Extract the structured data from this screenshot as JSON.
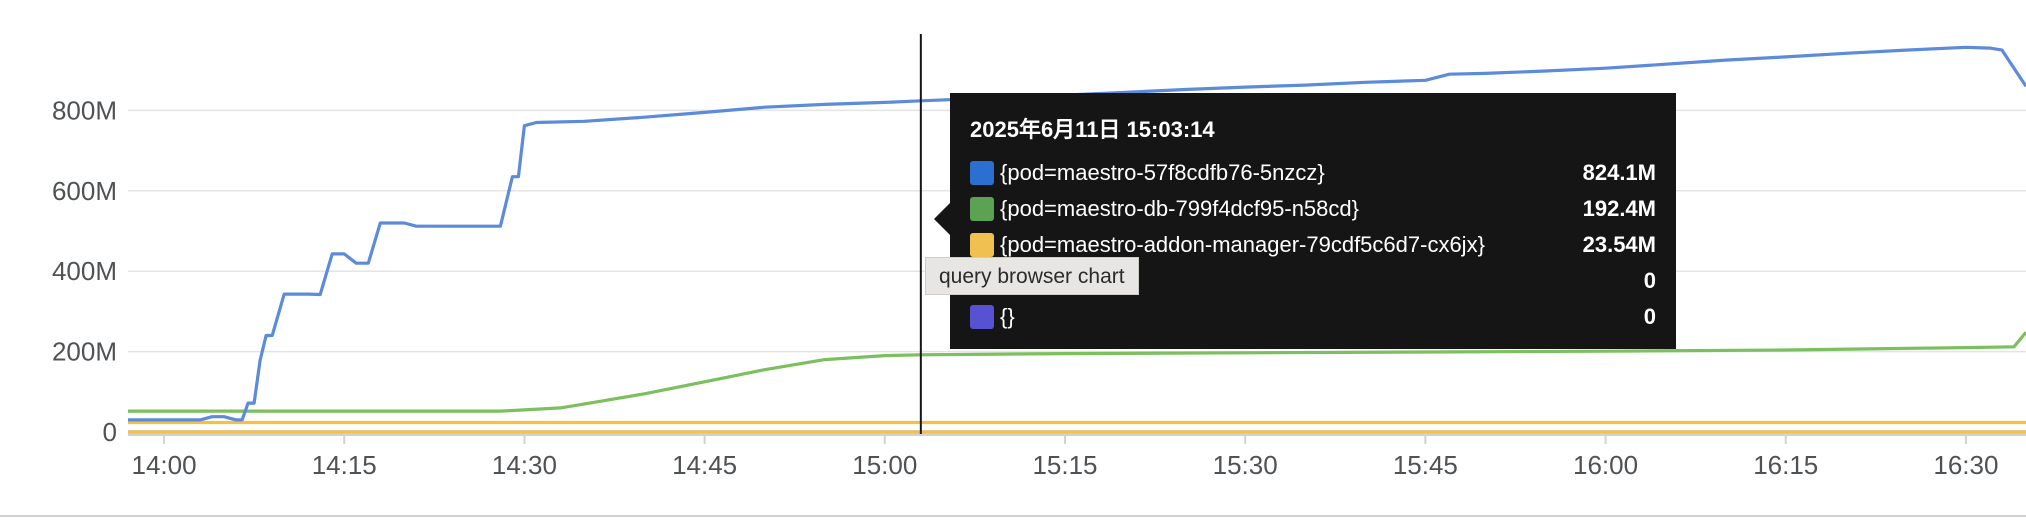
{
  "chart_data": {
    "type": "line",
    "title": "",
    "xlabel": "",
    "ylabel": "",
    "x_ticks": [
      "14:00",
      "14:15",
      "14:30",
      "14:45",
      "15:00",
      "15:15",
      "15:30",
      "15:45",
      "16:00",
      "16:15",
      "16:30"
    ],
    "xlim": [
      "13:57",
      "16:35"
    ],
    "y_ticks": [
      "0",
      "200M",
      "400M",
      "600M",
      "800M"
    ],
    "y_tick_values": [
      0,
      200,
      400,
      600,
      800
    ],
    "ylim": [
      0,
      1000
    ],
    "y_unit": "M",
    "grid": "horizontal",
    "legend": "none",
    "series": [
      {
        "name": "{pod=maestro-57f8cdfb76-5nzcz}",
        "color": "#5b8bd9",
        "points": [
          [
            "13:57",
            30
          ],
          [
            "14:03",
            30
          ],
          [
            "14:04",
            38
          ],
          [
            "14:05",
            38
          ],
          [
            "14:06",
            30
          ],
          [
            "14:06.5",
            30
          ],
          [
            "14:07",
            72
          ],
          [
            "14:07.5",
            72
          ],
          [
            "14:08",
            178
          ],
          [
            "14:08.5",
            240
          ],
          [
            "14:09",
            240
          ],
          [
            "14:10",
            343
          ],
          [
            "14:12",
            343
          ],
          [
            "14:13",
            342
          ],
          [
            "14:14",
            443
          ],
          [
            "14:15",
            443
          ],
          [
            "14:16",
            420
          ],
          [
            "14:17",
            420
          ],
          [
            "14:18",
            520
          ],
          [
            "14:20",
            520
          ],
          [
            "14:21",
            512
          ],
          [
            "14:28",
            512
          ],
          [
            "14:29",
            635
          ],
          [
            "14:29.5",
            635
          ],
          [
            "14:30",
            762
          ],
          [
            "14:31",
            770
          ],
          [
            "14:35",
            773
          ],
          [
            "14:40",
            783
          ],
          [
            "14:45",
            795
          ],
          [
            "14:50",
            808
          ],
          [
            "14:55",
            815
          ],
          [
            "15:00",
            820
          ],
          [
            "15:03",
            824
          ],
          [
            "15:10",
            832
          ],
          [
            "15:15",
            838
          ],
          [
            "15:20",
            845
          ],
          [
            "15:25",
            852
          ],
          [
            "15:30",
            858
          ],
          [
            "15:35",
            863
          ],
          [
            "15:40",
            870
          ],
          [
            "15:45",
            875
          ],
          [
            "15:47",
            890
          ],
          [
            "15:50",
            892
          ],
          [
            "15:55",
            898
          ],
          [
            "16:00",
            905
          ],
          [
            "16:05",
            915
          ],
          [
            "16:10",
            925
          ],
          [
            "16:15",
            933
          ],
          [
            "16:20",
            942
          ],
          [
            "16:25",
            950
          ],
          [
            "16:30",
            957
          ],
          [
            "16:32",
            955
          ],
          [
            "16:33",
            950
          ],
          [
            "16:34",
            905
          ],
          [
            "16:35",
            860
          ]
        ]
      },
      {
        "name": "{pod=maestro-db-799f4dcf95-n58cd}",
        "color": "#7bbf5e",
        "points": [
          [
            "13:57",
            52
          ],
          [
            "14:05",
            52
          ],
          [
            "14:28",
            52
          ],
          [
            "14:30",
            55
          ],
          [
            "14:33",
            60
          ],
          [
            "14:36",
            75
          ],
          [
            "14:40",
            95
          ],
          [
            "14:45",
            125
          ],
          [
            "14:50",
            155
          ],
          [
            "14:55",
            180
          ],
          [
            "15:00",
            190
          ],
          [
            "15:03",
            192
          ],
          [
            "15:15",
            195
          ],
          [
            "15:30",
            197
          ],
          [
            "15:45",
            199
          ],
          [
            "16:00",
            201
          ],
          [
            "16:15",
            204
          ],
          [
            "16:30",
            210
          ],
          [
            "16:34",
            212
          ],
          [
            "16:35",
            248
          ]
        ]
      },
      {
        "name": "{pod=maestro-addon-manager-79cdf5c6d7-cx6jx}",
        "color": "#f4c145",
        "points": [
          [
            "13:57",
            23.54
          ],
          [
            "16:35",
            23.54
          ]
        ]
      },
      {
        "name": "",
        "color": "#f4c145",
        "points": [
          [
            "13:57",
            0
          ],
          [
            "16:35",
            0
          ]
        ]
      },
      {
        "name": "{}",
        "color": "#5752d1",
        "points": [
          [
            "13:57",
            0
          ],
          [
            "16:35",
            0
          ]
        ]
      }
    ],
    "hover": {
      "time": "15:03",
      "title": "2025年6月11日 15:03:14",
      "rows": [
        {
          "name": "{pod=maestro-57f8cdfb76-5nzcz}",
          "value": "824.1M",
          "color": "#2b6fd0"
        },
        {
          "name": "{pod=maestro-db-799f4dcf95-n58cd}",
          "value": "192.4M",
          "color": "#5ba352"
        },
        {
          "name": "{pod=maestro-addon-manager-79cdf5c6d7-cx6jx}",
          "value": "23.54M",
          "color": "#f0c050"
        },
        {
          "name": "",
          "value": "0",
          "color": "#f0c050"
        },
        {
          "name": "{}",
          "value": "0",
          "color": "#5752d1"
        }
      ]
    }
  },
  "hover_label": "query browser chart"
}
